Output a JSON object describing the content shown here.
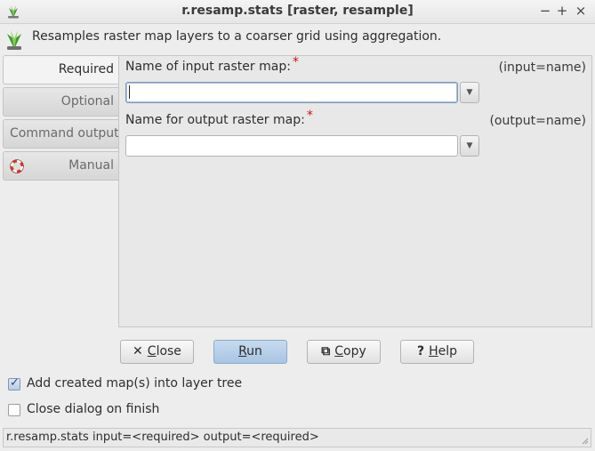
{
  "window": {
    "title": "r.resamp.stats [raster, resample]",
    "minimize_glyph": "−",
    "maximize_glyph": "+",
    "close_glyph": "×"
  },
  "header": {
    "description": "Resamples raster map layers to a coarser grid using aggregation.",
    "icon": "grass-logo-icon"
  },
  "tabs": [
    {
      "label": "Required",
      "active": true
    },
    {
      "label": "Optional",
      "active": false
    },
    {
      "label": "Command output",
      "active": false
    },
    {
      "label": "Manual",
      "active": false,
      "icon": "lifebuoy-icon"
    }
  ],
  "fields": {
    "input": {
      "label": "Name of input raster map:",
      "required_mark": "*",
      "key": "(input=name)",
      "value": ""
    },
    "output": {
      "label": "Name for output raster map:",
      "required_mark": "*",
      "key": "(output=name)",
      "value": ""
    }
  },
  "buttons": {
    "close": {
      "icon": "✕",
      "label_underlined": "C",
      "label_rest": "lose"
    },
    "run": {
      "label_underlined": "R",
      "label_rest": "un"
    },
    "copy": {
      "icon": "⧉",
      "label_underlined": "C",
      "label_rest": "opy"
    },
    "help": {
      "icon": "?",
      "label_underlined": "H",
      "label_rest": "elp"
    }
  },
  "options": {
    "add_to_layer_tree": {
      "label": "Add created map(s) into layer tree",
      "checked": true
    },
    "close_on_finish": {
      "label": "Close dialog on finish",
      "checked": false
    }
  },
  "status": {
    "command": "r.resamp.stats input=<required> output=<required>"
  },
  "colors": {
    "required_mark": "#d01010",
    "run_button": "#b6d0ea",
    "grass_green": "#3e9a2e"
  }
}
